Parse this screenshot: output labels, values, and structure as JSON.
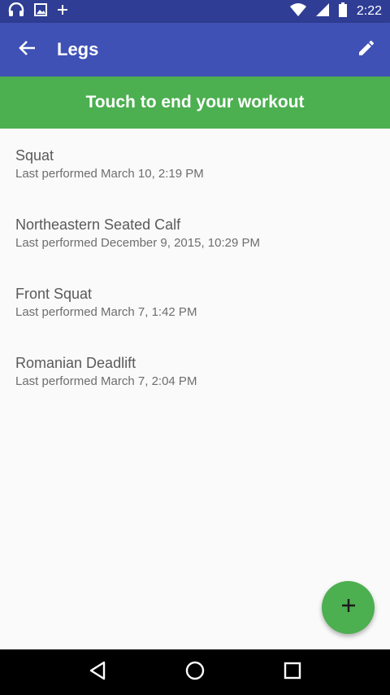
{
  "status_bar": {
    "time": "2:22",
    "left_icons": [
      "headphones-icon",
      "image-icon",
      "plus-icon"
    ],
    "right_icons": [
      "wifi-icon",
      "signal-icon",
      "battery-icon"
    ]
  },
  "app_bar": {
    "title": "Legs",
    "back_icon": "arrow-back-icon",
    "edit_icon": "pencil-icon",
    "color": "#3f51b5"
  },
  "end_workout": {
    "label": "Touch to end your workout",
    "color": "#4caf50"
  },
  "exercises": [
    {
      "name": "Squat",
      "last_performed": "Last performed March 10, 2:19 PM"
    },
    {
      "name": "Northeastern Seated Calf",
      "last_performed": "Last performed December 9, 2015, 10:29 PM"
    },
    {
      "name": "Front Squat",
      "last_performed": "Last performed March 7, 1:42 PM"
    },
    {
      "name": "Romanian Deadlift",
      "last_performed": "Last performed March 7, 2:04 PM"
    }
  ],
  "fab": {
    "icon": "add-icon",
    "color": "#4caf50"
  },
  "nav_bar": {
    "icons": [
      "back-triangle-icon",
      "home-circle-icon",
      "recents-square-icon"
    ]
  }
}
